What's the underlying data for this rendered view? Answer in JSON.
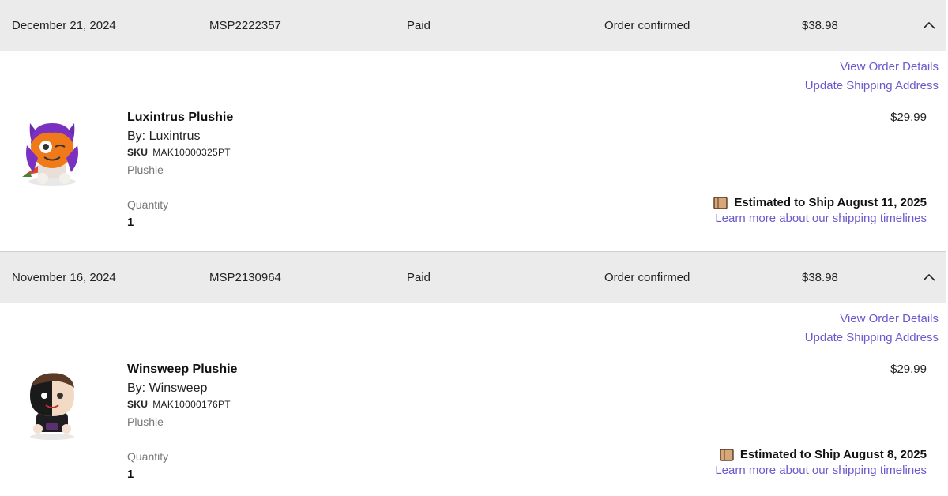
{
  "orders": [
    {
      "date": "December 21, 2024",
      "order_number": "MSP2222357",
      "payment_status": "Paid",
      "order_status": "Order confirmed",
      "total": "$38.98",
      "links": {
        "view_details": "View Order Details",
        "update_shipping": "Update Shipping Address"
      },
      "item": {
        "name": "Luxintrus Plushie",
        "by": "By: Luxintrus",
        "sku_label": "SKU",
        "sku": "MAK10000325PT",
        "type": "Plushie",
        "quantity_label": "Quantity",
        "quantity": "1",
        "price": "$29.99",
        "ship_estimate": "Estimated to Ship August 11, 2025",
        "ship_link": "Learn more about our shipping timelines"
      }
    },
    {
      "date": "November 16, 2024",
      "order_number": "MSP2130964",
      "payment_status": "Paid",
      "order_status": "Order confirmed",
      "total": "$38.98",
      "links": {
        "view_details": "View Order Details",
        "update_shipping": "Update Shipping Address"
      },
      "item": {
        "name": "Winsweep Plushie",
        "by": "By: Winsweep",
        "sku_label": "SKU",
        "sku": "MAK10000176PT",
        "type": "Plushie",
        "quantity_label": "Quantity",
        "quantity": "1",
        "price": "$29.99",
        "ship_estimate": "Estimated to Ship August 8, 2025",
        "ship_link": "Learn more about our shipping timelines"
      }
    }
  ],
  "icons": {
    "collapse": "chevron-up-icon",
    "shipping": "box-icon"
  },
  "colors": {
    "header_bg": "#ebebeb",
    "link": "#6a5acd",
    "muted_text": "#777777"
  }
}
